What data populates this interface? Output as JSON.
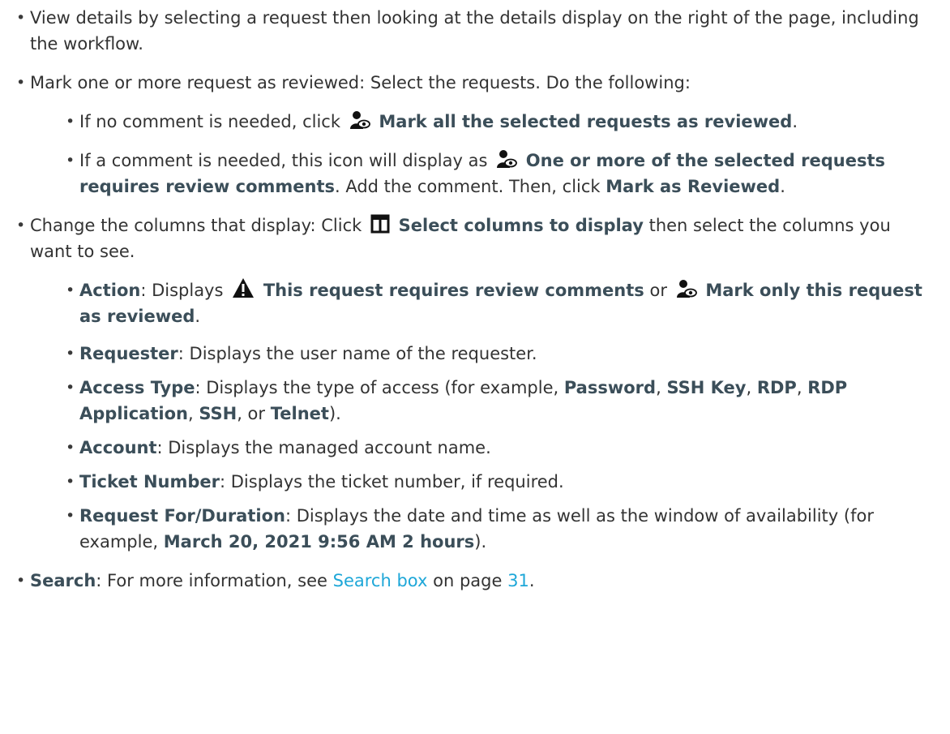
{
  "items": {
    "view_details": "View details by selecting a request then looking at the details display on the right of the page, including the workflow.",
    "mark_reviewed": {
      "text": "Mark one or more request as reviewed: Select the requests. Do the following:",
      "sub1": {
        "before": "If no comment is needed, click",
        "bold": "Mark all the selected requests as reviewed",
        "after": "."
      },
      "sub2": {
        "before": "If a comment is needed, this icon will display as",
        "bold1": "One or more of the selected requests requires review comments",
        "mid": ". Add the comment. Then, click",
        "bold2": "Mark as Reviewed",
        "after": "."
      }
    },
    "change_columns": {
      "before": "Change the columns that display: Click",
      "bold": "Select columns to display",
      "after": "then select the columns you want to see.",
      "columns": {
        "action": {
          "label": "Action",
          "before": ": Displays",
          "bold1": "This request requires review comments",
          "mid": "or",
          "bold2": "Mark only this request as reviewed",
          "after": "."
        },
        "requester": {
          "label": "Requester",
          "text": ": Displays the user name of the requester."
        },
        "access_type": {
          "label": "Access Type",
          "before": ": Displays the type of access (for example,",
          "v1": "Password",
          "v2": "SSH Key",
          "v3": "RDP",
          "v4": "RDP Application",
          "v5": "SSH",
          "or": ", or",
          "v6": "Telnet",
          "after": ")."
        },
        "account": {
          "label": "Account",
          "text": ": Displays the managed account name."
        },
        "ticket": {
          "label": "Ticket Number",
          "text": ": Displays the ticket number, if required."
        },
        "request_for": {
          "label": "Request For/Duration",
          "before": ": Displays the date and time as well as the window of availability (for example,",
          "example": "March 20, 2021 9:56 AM 2 hours",
          "after": ")."
        }
      }
    },
    "search": {
      "label": "Search",
      "before": ": For more information, see",
      "link": "Search box",
      "mid": "on page",
      "page": "31",
      "after": "."
    }
  },
  "icons": {
    "user_review": "user-review-icon",
    "columns": "columns-icon",
    "warning": "warning-icon"
  },
  "colors": {
    "text": "#333333",
    "bold_text": "#3b4e59",
    "link": "#1ea7d8"
  }
}
